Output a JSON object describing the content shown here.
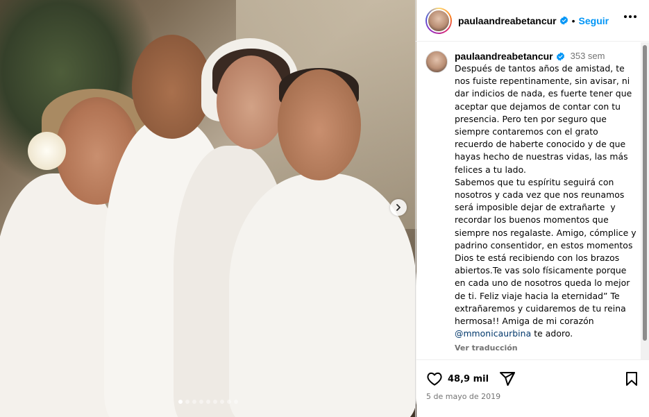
{
  "post": {
    "username": "paulaandreabetancur",
    "follow_label": "Seguir",
    "bullet": "•",
    "photo_count": 9,
    "active_photo_index": 0
  },
  "caption": {
    "username": "paulaandreabetancur",
    "time": "353 sem",
    "text": "Después de tantos años de amistad, te nos fuiste repentinamente, sin avisar, ni dar indicios de nada, es fuerte tener que aceptar que dejamos de contar con tu presencia. Pero ten por seguro que siempre contaremos con el grato recuerdo de haberte conocido y de que hayas hecho de nuestras vidas, las más felices a tu lado.\nSabemos que tu espíritu seguirá con nosotros y cada vez que nos reunamos será imposible dejar de extrañarte  y recordar los buenos momentos que siempre nos regalaste. Amigo, cómplice y padrino consentidor, en estos momentos Dios te está recibiendo con los brazos abiertos.Te vas solo físicamente porque en cada uno de nosotros queda lo mejor de ti. Feliz viaje hacia la eternidad” Te extrañaremos y cuidaremos de tu reina hermosa!! Amiga de mi corazón ",
    "mention": "@mmonicaurbina",
    "text_end": " te adoro.",
    "translate_label": "Ver traducción"
  },
  "engagement": {
    "likes": "48,9 mil",
    "date": "5 de mayo de 2019"
  },
  "icons": {
    "verified": "verified-badge-icon",
    "more": "more-options-icon",
    "like": "heart-icon",
    "share": "share-icon",
    "save": "bookmark-icon",
    "next": "chevron-right-icon"
  },
  "colors": {
    "link_blue": "#0095f6",
    "mention_blue": "#00376b",
    "secondary_text": "#737373"
  }
}
